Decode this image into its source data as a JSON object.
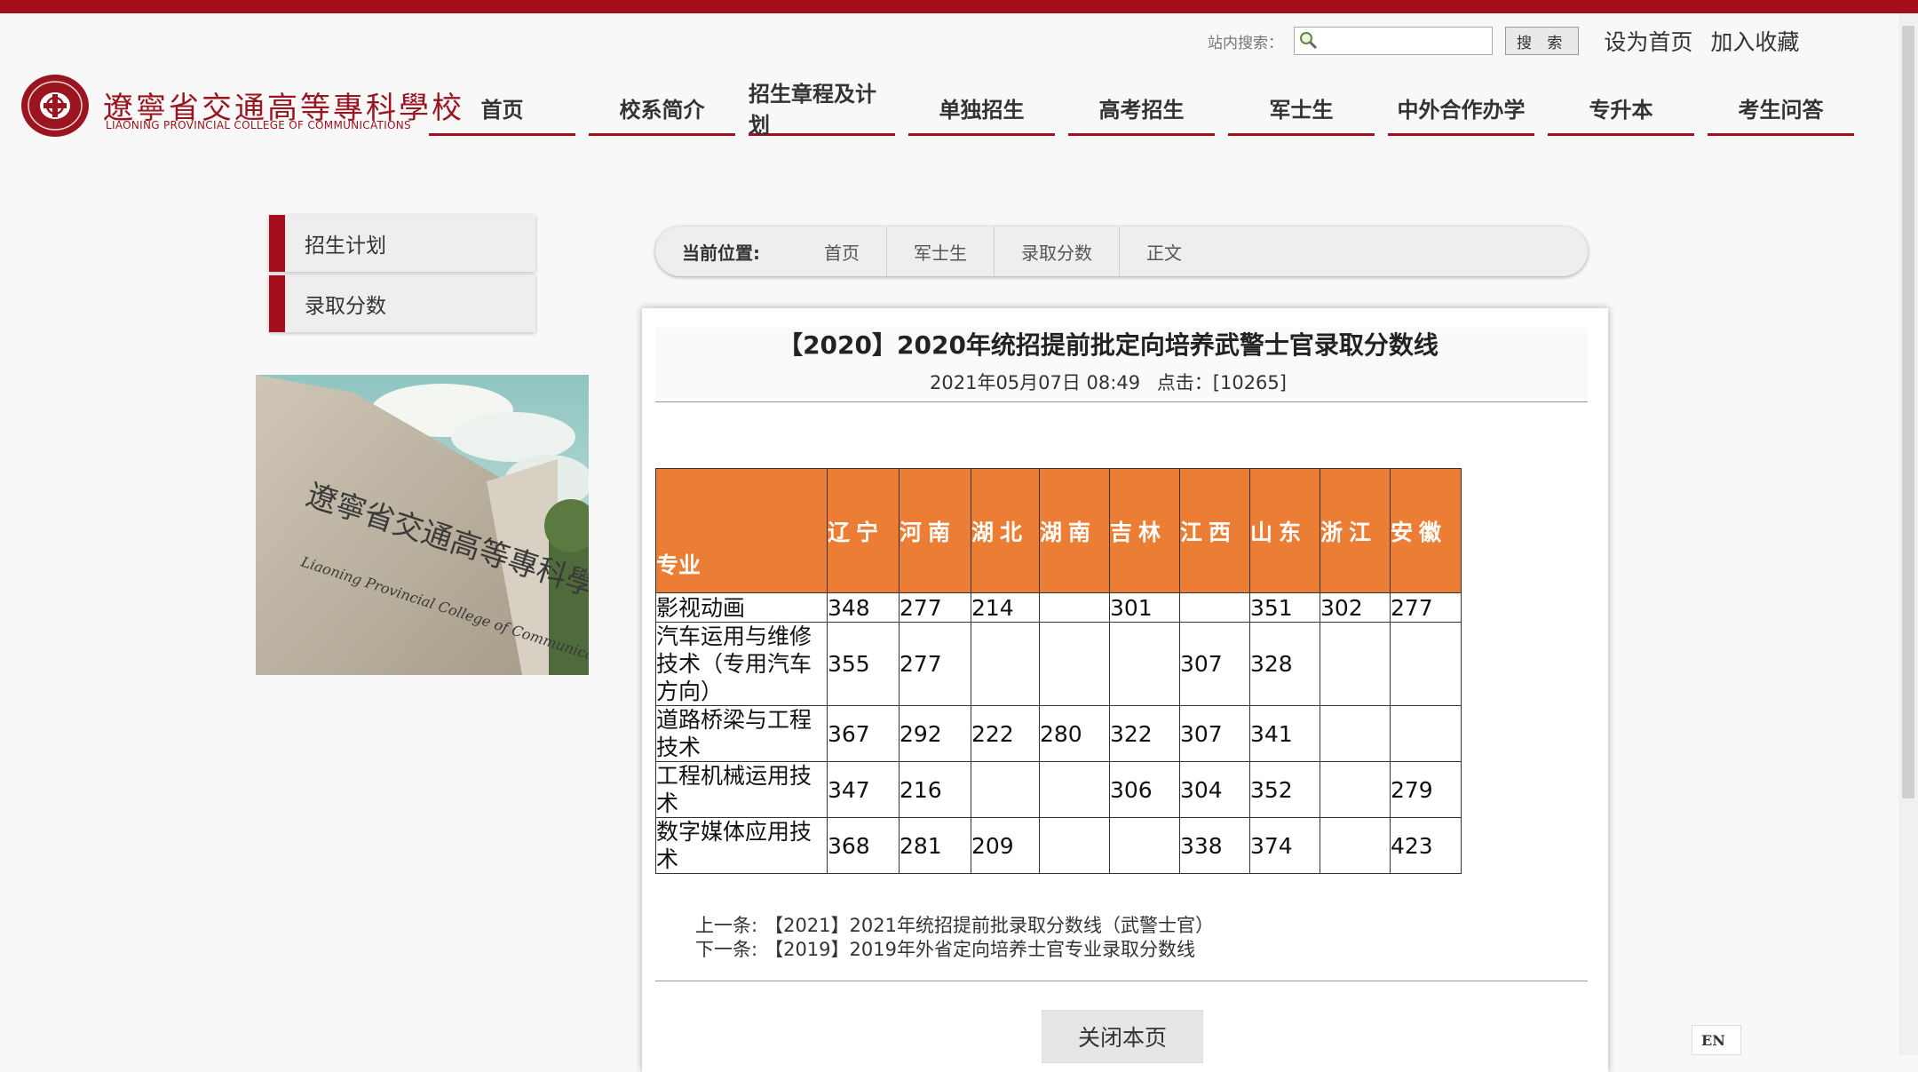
{
  "header": {
    "search_label": "站内搜索：",
    "search_value": "",
    "search_button": "搜 索",
    "set_home": "设为首页",
    "add_favorite": "加入收藏"
  },
  "logo": {
    "cn": "遼寧省交通高等專科學校",
    "en": "LIAONING PROVINCIAL COLLEGE OF COMMUNICATIONS"
  },
  "nav": [
    "首页",
    "校系简介",
    "招生章程及计划",
    "单独招生",
    "高考招生",
    "军士生",
    "中外合作办学",
    "专升本",
    "考生问答"
  ],
  "sidebar": {
    "items": [
      "招生计划",
      "录取分数"
    ],
    "photo_caption_cn": "遼寧省交通高等專科學校",
    "photo_caption_en": "Liaoning Provincial College of Communications"
  },
  "breadcrumb": {
    "label": "当前位置:",
    "items": [
      "首页",
      "军士生",
      "录取分数",
      "正文"
    ]
  },
  "article": {
    "title": "【2020】2020年统招提前批定向培养武警士官录取分数线",
    "date": "2021年05月07日 08:49",
    "hits": "点击：[10265]"
  },
  "table": {
    "major_header": "专业",
    "provinces": [
      "辽宁",
      "河南",
      "湖北",
      "湖南",
      "吉林",
      "江西",
      "山东",
      "浙江",
      "安徽"
    ],
    "rows": [
      {
        "major": "影视动画",
        "scores": [
          "348",
          "277",
          "214",
          "",
          "301",
          "",
          "351",
          "302",
          "277"
        ]
      },
      {
        "major": "汽车运用与维修技术（专用汽车方向）",
        "scores": [
          "355",
          "277",
          "",
          "",
          "",
          "307",
          "328",
          "",
          ""
        ]
      },
      {
        "major": "道路桥梁与工程技术",
        "scores": [
          "367",
          "292",
          "222",
          "280",
          "322",
          "307",
          "341",
          "",
          ""
        ]
      },
      {
        "major": "工程机械运用技术",
        "scores": [
          "347",
          "216",
          "",
          "",
          "306",
          "304",
          "352",
          "",
          "279"
        ]
      },
      {
        "major": "数字媒体应用技术",
        "scores": [
          "368",
          "281",
          "209",
          "",
          "",
          "338",
          "374",
          "",
          "423"
        ]
      }
    ]
  },
  "prev_next": {
    "prev_label": "上一条:",
    "prev_title": "【2021】2021年统招提前批录取分数线（武警士官）",
    "next_label": "下一条:",
    "next_title": "【2019】2019年外省定向培养士官专业录取分数线"
  },
  "close_button": "关闭本页",
  "lang_button": "EN",
  "colors": {
    "brand_red": "#a50f1b",
    "table_header": "#ec7d34"
  }
}
